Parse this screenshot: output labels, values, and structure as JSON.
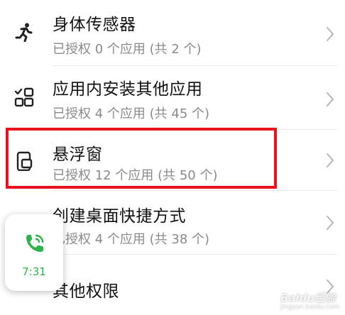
{
  "permissions": [
    {
      "title": "身体传感器",
      "subtitle": "已授权 0 个应用 (共 2 个)",
      "icon": "running-person-icon"
    },
    {
      "title": "应用内安装其他应用",
      "subtitle": "已授权 4 个应用 (共 45 个)",
      "icon": "app-grid-check-icon"
    },
    {
      "title": "悬浮窗",
      "subtitle": "已授权 12 个应用 (共 50 个)",
      "icon": "floating-window-icon"
    },
    {
      "title": "创建桌面快捷方式",
      "subtitle": "已授权 4 个应用 (共 38 个)",
      "icon": "shortcut-arrow-icon"
    },
    {
      "title": "其他权限",
      "subtitle": "",
      "icon": "more-icon"
    }
  ],
  "floating_call": {
    "time": "7:31",
    "accent": "#2db34a"
  },
  "highlight_color": "#e8131f",
  "watermark": {
    "text": "Baidu经验",
    "sub": "jingyan.baidu.com"
  }
}
